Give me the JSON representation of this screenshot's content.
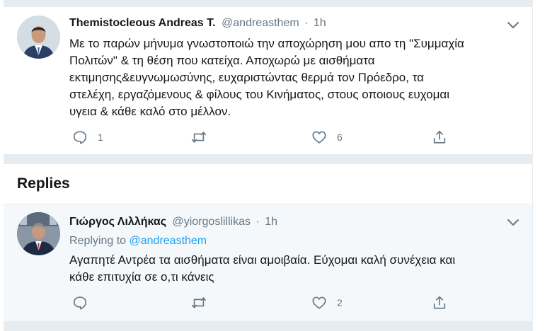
{
  "tweet": {
    "name": "Themistocleous Andreas T.",
    "handle": "@andreasthem",
    "separator": "·",
    "time": "1h",
    "lines": [
      "Με το παρών μήνυμα γνωστοποιώ την αποχώρηση μου απο τη \"Συμμαχία",
      "Πολιτών\" & τη θέση που κατείχα. Αποχωρώ με αισθήματα",
      "εκτιμησης&ευγνωμωσύνης, ευχαριστώντας θερμά τον Πρόεδρο, τα",
      "στελέχη, εργαζόμενους & φίλους του Κινήματος, στους οποιους ευχομαι",
      "υγεια & κάθε καλό στο μέλλον."
    ],
    "reply_count": "1",
    "retweet_count": "",
    "like_count": "6",
    "icons": {
      "reply": "reply-icon",
      "retweet": "retweet-icon",
      "like": "heart-icon",
      "share": "share-icon",
      "menu": "chevron-down-icon"
    }
  },
  "replies_header": "Replies",
  "reply": {
    "name": "Γιώργος Λιλλήκας",
    "handle": "@yiorgoslillikas",
    "separator": "·",
    "time": "1h",
    "replying_prefix": "Replying to",
    "replying_to": "@andreasthem",
    "lines": [
      "Αγαπητέ Αντρέα τα αισθήματα είναι αμοιβαία. Εύχομαι καλή συνέχεια και",
      "κάθε επιτυχία σε ο,τι κάνεις"
    ],
    "reply_count": "",
    "retweet_count": "",
    "like_count": "2"
  },
  "colors": {
    "accent": "#1da1f2",
    "secondary_text": "#657786",
    "divider": "#e6ecf0"
  }
}
